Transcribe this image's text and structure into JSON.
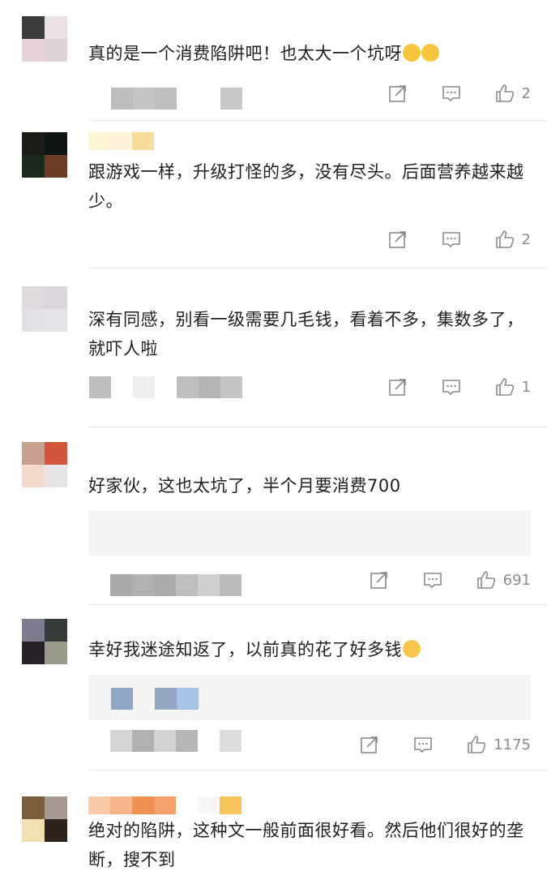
{
  "comments": [
    {
      "text": "真的是一个消费陷阱吧！也太大一个坑呀",
      "emoji_names": [
        "laugh-cry-emoji",
        "laugh-cry-emoji"
      ],
      "likes": "2",
      "avatar_colors": [
        "#3b3b3b",
        "#e9e1e3",
        "#e6d3da",
        "#ded2d8"
      ],
      "meta_colors": [
        "#ffffff",
        "#bdbdbd",
        "#c5c5c5",
        "#bebebe",
        "#ffffff",
        "#ffffff",
        "#ffffff",
        "#c8c8c8"
      ],
      "name_colors": []
    },
    {
      "text": "跟游戏一样，升级打怪的多，没有尽头。后面营养越来越少。",
      "likes": "2",
      "avatar_colors": [
        "#1b1c18",
        "#0e1412",
        "#1a2a1c",
        "#6b3b24"
      ],
      "name_colors": [
        "#fcf6d3",
        "#fdf2d7",
        "#f9dc9a"
      ]
    },
    {
      "text": "深有同感，别看一级需要几毛钱，看着不多，集数多了，就吓人啦",
      "likes": "1",
      "avatar_colors": [
        "#dedadd",
        "#dcd7dd",
        "#e3e0e6",
        "#e5e3e8"
      ],
      "name_colors": [
        "#f5f5f5",
        "#f2f2f2",
        "#eeeeee",
        "#f0f0f0",
        "#eaeaea"
      ],
      "meta_colors": [
        "#bdbdbd",
        "#ffffff",
        "#efefef",
        "#ffffff",
        "#bfbfbf",
        "#b3b3b3",
        "#c4c4c4"
      ]
    },
    {
      "text": "好家伙，这也太坑了，半个月要消费700",
      "likes": "691",
      "avatar_colors": [
        "#c7a08f",
        "#d2553b",
        "#f3d9cb",
        "#e8e6e4"
      ],
      "name_colors": [
        "#f4f4f4",
        "#f1f1f1",
        "#f6f6f6"
      ],
      "meta_colors": [
        "#a9a9a9",
        "#b1b1b1",
        "#ababab",
        "#bebebe",
        "#cfcfcf",
        "#bababa"
      ]
    },
    {
      "text": "幸好我迷途知返了，以前真的花了好多钱",
      "emoji_names": [
        "crying-emoji"
      ],
      "likes": "1175",
      "avatar_colors": [
        "#7c7c8e",
        "#353b37",
        "#272228",
        "#9a9a8b"
      ],
      "name_colors": [
        "#efefef",
        "#f1f1f1",
        "#ececec"
      ],
      "quote_chips": [
        "#8fa6c7",
        "#f5f5f5",
        "#95a6c2",
        "#a8c2e4"
      ],
      "meta_colors": [
        "#d5d5d5",
        "#b1b1b1",
        "#d2d2d2",
        "#b6b6b6",
        "#ffffff",
        "#dcdcdc"
      ]
    },
    {
      "text": "绝对的陷阱，这种文一般前面很好看。然后他们很好的垄断，搜不到",
      "avatar_colors": [
        "#7a5d3c",
        "#a59b92",
        "#f2dfb2",
        "#2c241c"
      ],
      "name_colors": [
        "#f8c9a8",
        "#f6b48c",
        "#ef914f",
        "#f4a06a",
        "#ffffff",
        "#f7f7f7",
        "#f8c55a"
      ]
    }
  ]
}
